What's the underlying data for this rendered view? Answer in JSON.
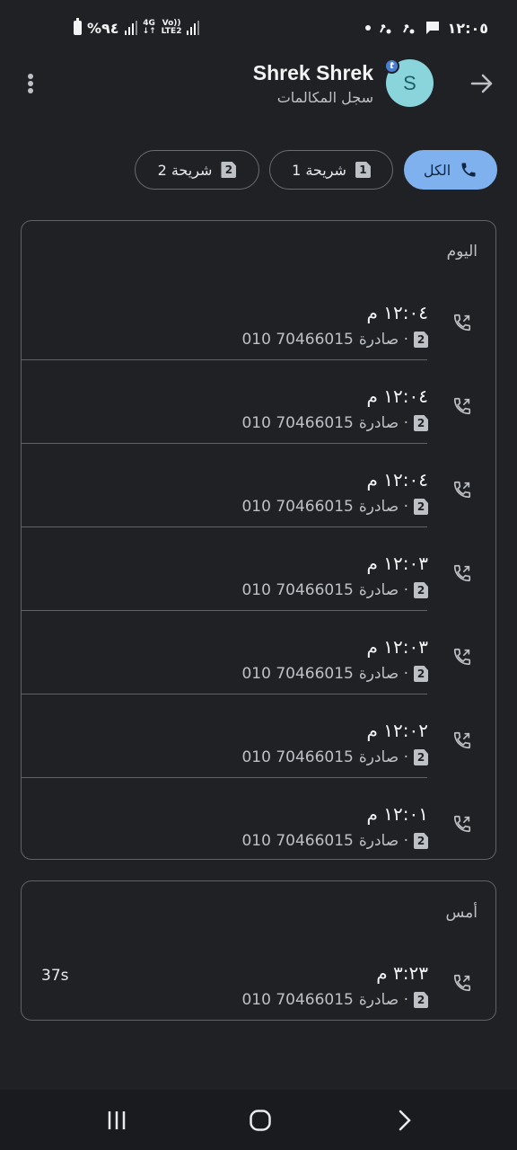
{
  "status_bar": {
    "time": "١٢:٠٥",
    "battery": "%٩٤",
    "network_4g": "4G",
    "network_volte": "Vo))",
    "network_lte2": "LTE2"
  },
  "header": {
    "contact_name": "Shrek Shrek",
    "subtitle": "سجل المكالمات",
    "avatar_letter": "S",
    "avatar_badge": "t"
  },
  "filters": {
    "all_label": "الكل",
    "sim1_label": "شريحة 1",
    "sim1_number": "1",
    "sim2_label": "شريحة 2",
    "sim2_number": "2"
  },
  "sections": {
    "today": {
      "heading": "اليوم",
      "entries": [
        {
          "time": "١٢:٠٤ م",
          "sim": "2",
          "type": "صادرة ·",
          "number": "010 70466015"
        },
        {
          "time": "١٢:٠٤ م",
          "sim": "2",
          "type": "صادرة ·",
          "number": "010 70466015"
        },
        {
          "time": "١٢:٠٤ م",
          "sim": "2",
          "type": "صادرة ·",
          "number": "010 70466015"
        },
        {
          "time": "١٢:٠٣ م",
          "sim": "2",
          "type": "صادرة ·",
          "number": "010 70466015"
        },
        {
          "time": "١٢:٠٣ م",
          "sim": "2",
          "type": "صادرة ·",
          "number": "010 70466015"
        },
        {
          "time": "١٢:٠٢ م",
          "sim": "2",
          "type": "صادرة ·",
          "number": "010 70466015"
        },
        {
          "time": "١٢:٠١ م",
          "sim": "2",
          "type": "صادرة ·",
          "number": "010 70466015"
        }
      ]
    },
    "yesterday": {
      "heading": "أمس",
      "entries": [
        {
          "time": "٣:٢٣ م",
          "sim": "2",
          "type": "صادرة ·",
          "number": "010 70466015",
          "duration": "37s"
        }
      ]
    }
  },
  "colors": {
    "background": "#202124",
    "chip_active": "#7fb1ee",
    "avatar": "#8ad4dc"
  },
  "icons": {
    "back": "arrow-right-icon",
    "more": "more-vert-icon",
    "outgoing_call": "outgoing-call-icon",
    "phone": "phone-icon",
    "sim": "sim-card-icon"
  }
}
